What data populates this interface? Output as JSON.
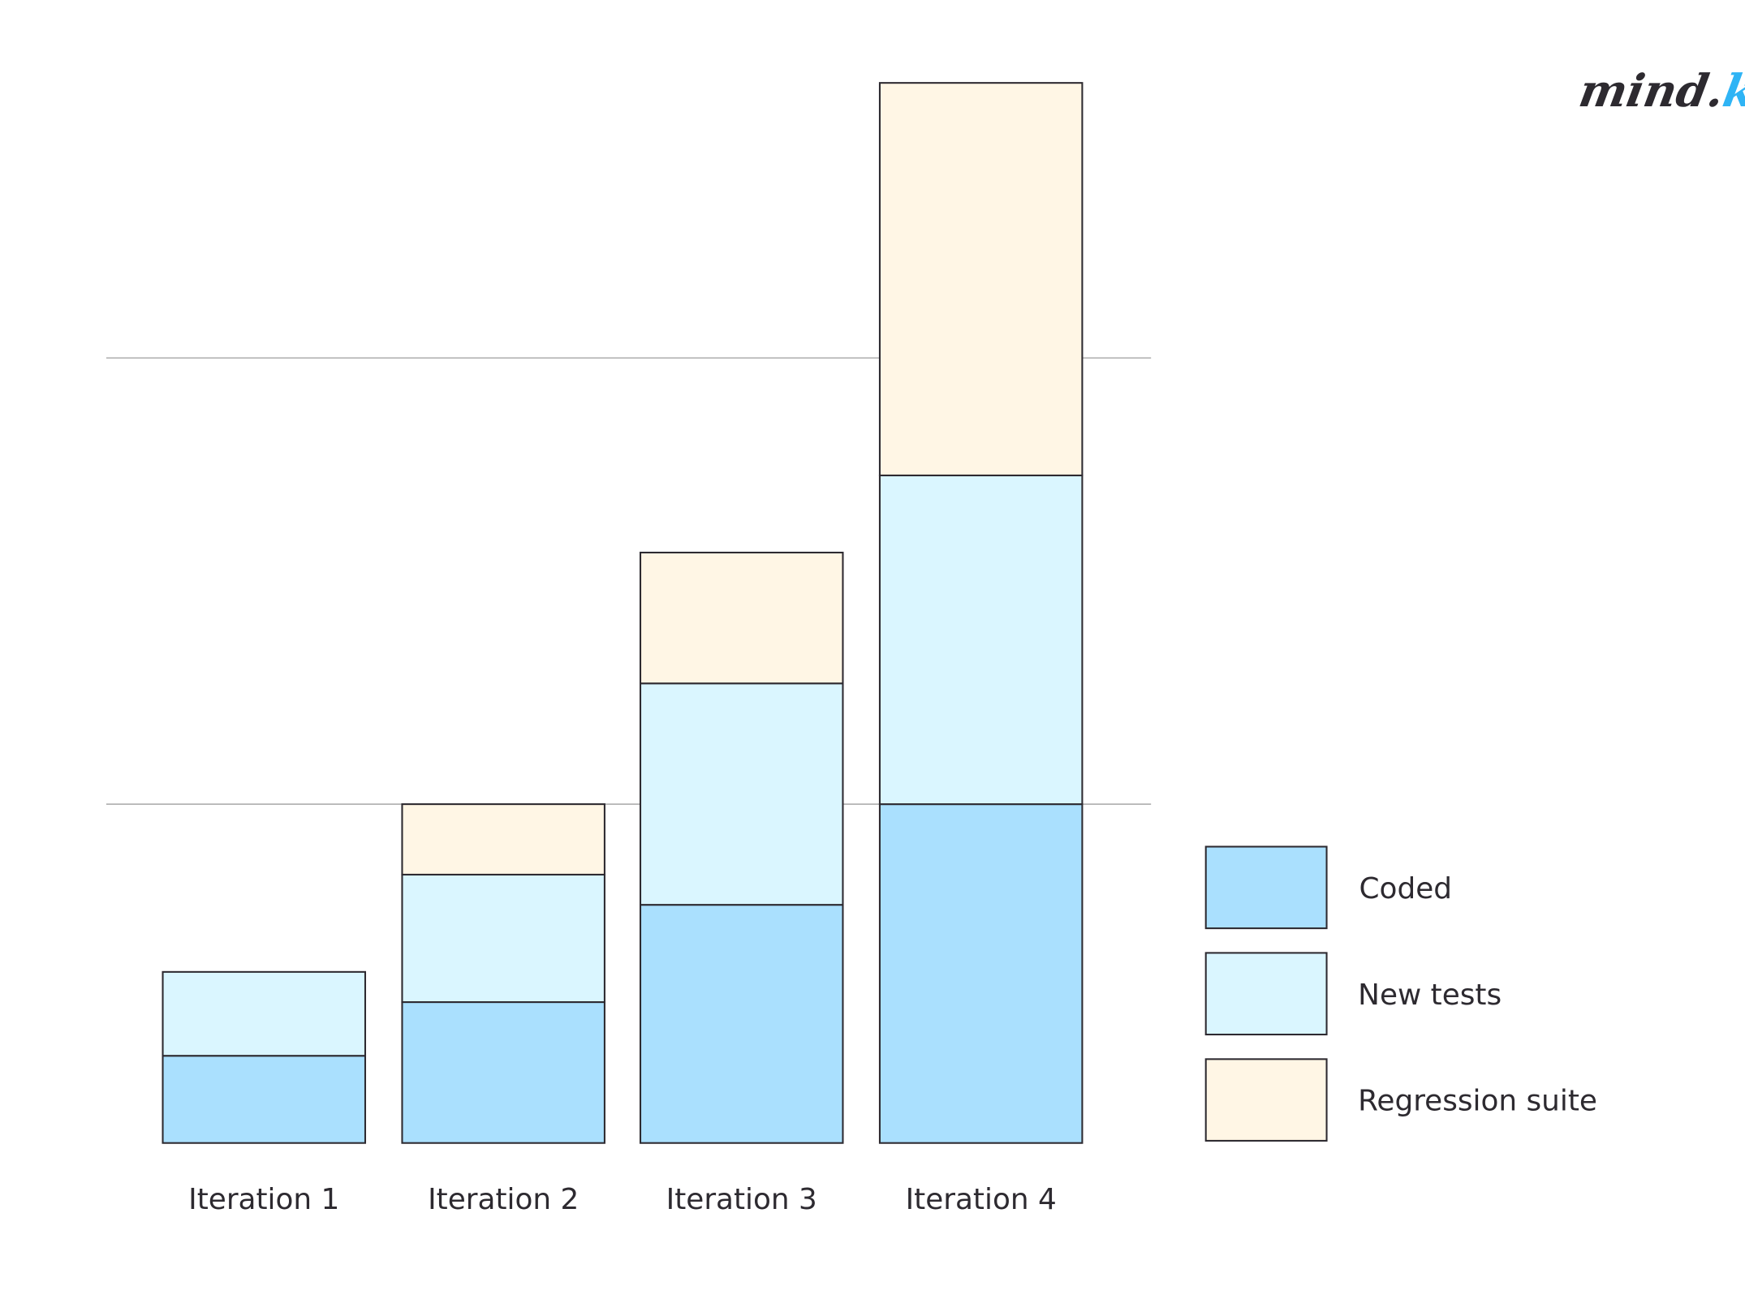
{
  "brand": {
    "logo_text": "mind.k",
    "logo_color": "#2d2a30",
    "logo_accent": "#2fb4f5"
  },
  "chart_data": {
    "type": "bar",
    "stacked": true,
    "title": "",
    "xlabel": "",
    "ylabel": "",
    "categories": [
      "Iteration 1",
      "Iteration 2",
      "Iteration 3",
      "Iteration 4"
    ],
    "series": [
      {
        "name": "Coded",
        "color": "#aae0fe",
        "values": [
          2.6,
          4.2,
          7.1,
          10.1
        ]
      },
      {
        "name": "New tests",
        "color": "#daf6ff",
        "values": [
          2.5,
          3.8,
          6.6,
          9.8
        ]
      },
      {
        "name": "Regression suite",
        "color": "#fff6e5",
        "values": [
          0,
          2.1,
          3.9,
          11.7
        ]
      }
    ],
    "gridlines": [
      10.1,
      23.4
    ],
    "grid": true,
    "ylim": [
      0,
      34
    ],
    "y_ticks_shown": false,
    "legend": "right",
    "stroke_color": "#2d2a30"
  }
}
